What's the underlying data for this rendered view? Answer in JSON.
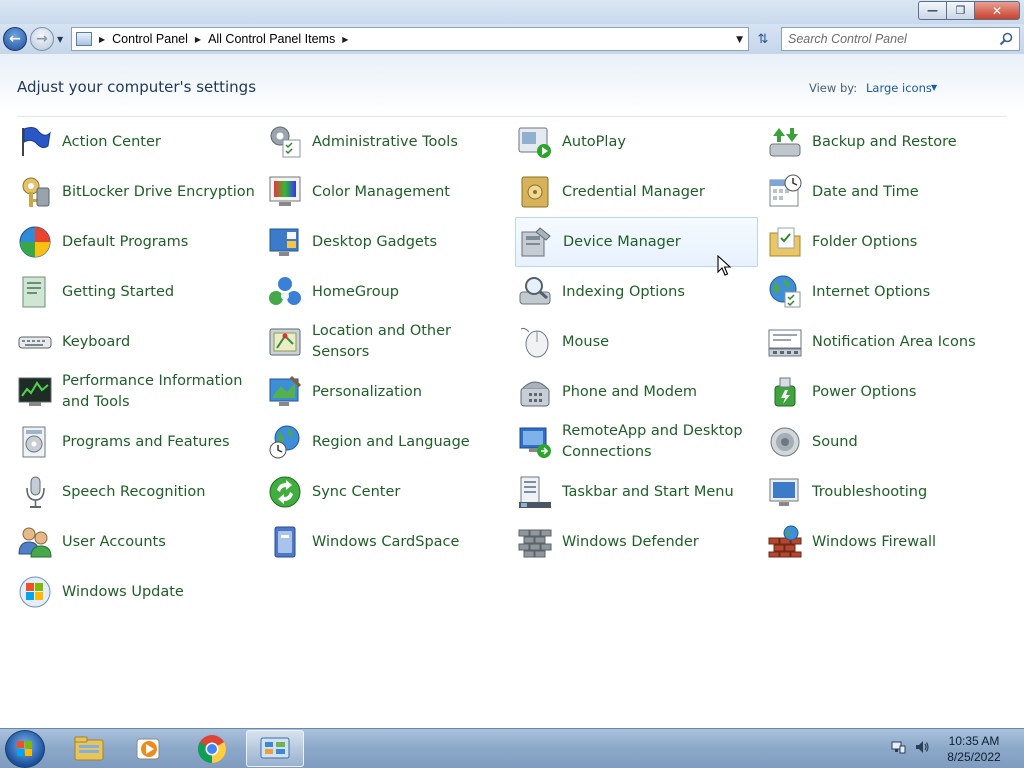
{
  "window": {
    "minimize": "—",
    "maximize": "❐",
    "close": "✕"
  },
  "address_bar": {
    "crumbs": [
      "Control Panel",
      "All Control Panel Items"
    ]
  },
  "search": {
    "placeholder": "Search Control Panel"
  },
  "header": {
    "title": "Adjust your computer's settings",
    "view_by_label": "View by:",
    "view_by_value": "Large icons"
  },
  "items": [
    {
      "label": "Action Center",
      "icon": "flag-icon"
    },
    {
      "label": "Administrative Tools",
      "icon": "tools-icon"
    },
    {
      "label": "AutoPlay",
      "icon": "autoplay-icon"
    },
    {
      "label": "Backup and Restore",
      "icon": "backup-icon"
    },
    {
      "label": "BitLocker Drive Encryption",
      "icon": "key-icon"
    },
    {
      "label": "Color Management",
      "icon": "color-icon"
    },
    {
      "label": "Credential Manager",
      "icon": "vault-icon"
    },
    {
      "label": "Date and Time",
      "icon": "calendar-icon"
    },
    {
      "label": "Default Programs",
      "icon": "windows-orb-icon"
    },
    {
      "label": "Desktop Gadgets",
      "icon": "gadgets-icon"
    },
    {
      "label": "Device Manager",
      "icon": "device-icon"
    },
    {
      "label": "Folder Options",
      "icon": "folder-icon"
    },
    {
      "label": "Getting Started",
      "icon": "document-icon"
    },
    {
      "label": "HomeGroup",
      "icon": "homegroup-icon"
    },
    {
      "label": "Indexing Options",
      "icon": "magnifier-icon"
    },
    {
      "label": "Internet Options",
      "icon": "globe-icon"
    },
    {
      "label": "Keyboard",
      "icon": "keyboard-icon"
    },
    {
      "label": "Location and Other Sensors",
      "icon": "sensor-icon"
    },
    {
      "label": "Mouse",
      "icon": "mouse-icon"
    },
    {
      "label": "Notification Area Icons",
      "icon": "notification-icon"
    },
    {
      "label": "Performance Information and Tools",
      "icon": "performance-icon"
    },
    {
      "label": "Personalization",
      "icon": "personalization-icon"
    },
    {
      "label": "Phone and Modem",
      "icon": "phone-icon"
    },
    {
      "label": "Power Options",
      "icon": "power-icon"
    },
    {
      "label": "Programs and Features",
      "icon": "programs-icon"
    },
    {
      "label": "Region and Language",
      "icon": "region-icon"
    },
    {
      "label": "RemoteApp and Desktop Connections",
      "icon": "remote-icon"
    },
    {
      "label": "Sound",
      "icon": "speaker-icon"
    },
    {
      "label": "Speech Recognition",
      "icon": "microphone-icon"
    },
    {
      "label": "Sync Center",
      "icon": "sync-icon"
    },
    {
      "label": "Taskbar and Start Menu",
      "icon": "taskbar-icon"
    },
    {
      "label": "Troubleshooting",
      "icon": "troubleshoot-icon"
    },
    {
      "label": "User Accounts",
      "icon": "users-icon"
    },
    {
      "label": "Windows CardSpace",
      "icon": "cardspace-icon"
    },
    {
      "label": "Windows Defender",
      "icon": "defender-icon"
    },
    {
      "label": "Windows Firewall",
      "icon": "firewall-icon"
    },
    {
      "label": "Windows Update",
      "icon": "update-icon"
    }
  ],
  "hovered_item": "Device Manager",
  "taskbar": {
    "pinned": [
      "explorer-icon",
      "media-player-icon",
      "chrome-icon",
      "control-panel-icon"
    ],
    "time": "10:35 AM",
    "date": "8/25/2022"
  },
  "colors": {
    "link_green": "#1e5f27",
    "title_blue": "#1e395b",
    "hover_border": "#b8d6fb"
  }
}
